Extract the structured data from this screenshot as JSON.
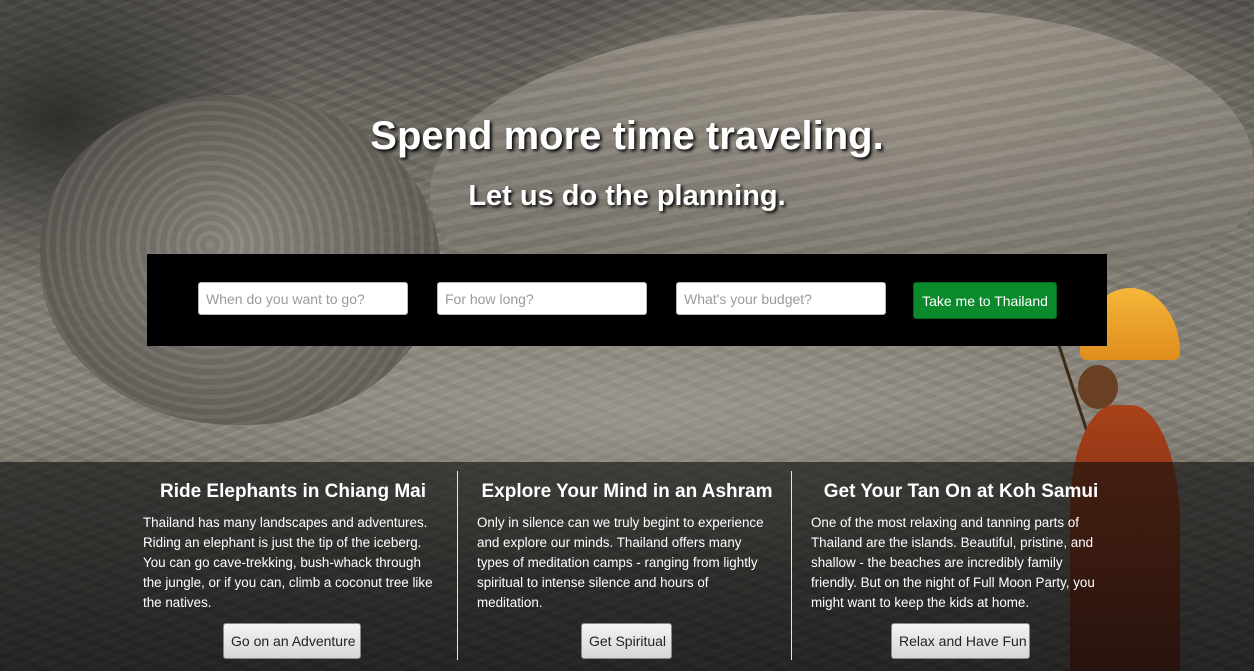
{
  "hero": {
    "headline": "Spend more time traveling.",
    "subheadline": "Let us do the planning."
  },
  "search": {
    "when_placeholder": "When do you want to go?",
    "length_placeholder": "For how long?",
    "budget_placeholder": "What's your budget?",
    "submit_label": "Take me to Thailand"
  },
  "features": [
    {
      "title": "Ride Elephants in Chiang Mai",
      "text": "Thailand has many landscapes and adventures. Riding an elephant is just the tip of the iceberg. You can go cave-trekking, bush-whack through the jungle, or if you can, climb a coconut tree like the natives.",
      "button": "Go on an Adventure"
    },
    {
      "title": "Explore Your Mind in an Ashram",
      "text": "Only in silence can we truly begint to experience and explore our minds. Thailand offers many types of meditation camps - ranging from lightly spiritual to intense silence and hours of meditation.",
      "button": "Get Spiritual"
    },
    {
      "title": "Get Your Tan On at Koh Samui",
      "text": "One of the most relaxing and tanning parts of Thailand are the islands. Beautiful, pristine, and shallow - the beaches are incredibly family friendly. But on the night of Full Moon Party, you might want to keep the kids at home.",
      "button": "Relax and Have Fun"
    }
  ],
  "colors": {
    "submit_button": "#0a8a2a",
    "form_background": "#000000",
    "text": "#ffffff"
  }
}
